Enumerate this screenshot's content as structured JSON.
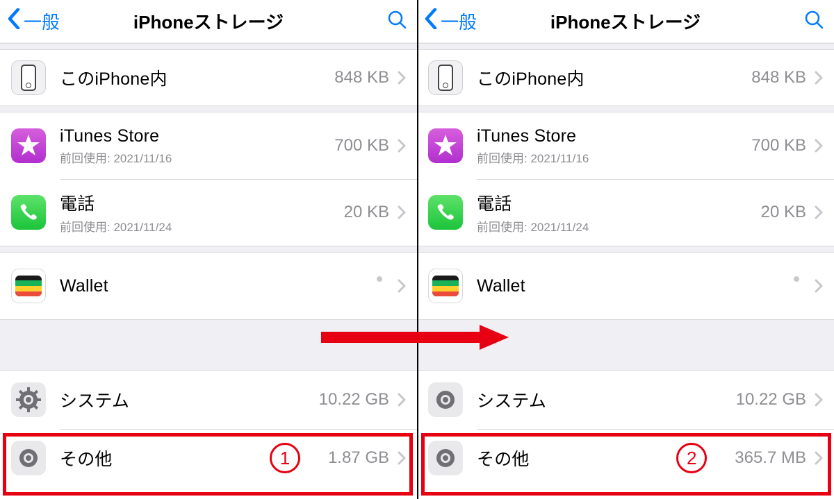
{
  "panes": [
    {
      "nav": {
        "back": "一般",
        "title": "iPhoneストレージ"
      },
      "group1": [
        {
          "icon": "oniphone",
          "title": "このiPhone内",
          "sub": "",
          "size": "848 KB",
          "spinner": false
        },
        {
          "icon": "itunes",
          "title": "iTunes Store",
          "sub": "前回使用: 2021/11/16",
          "size": "700 KB",
          "spinner": false
        },
        {
          "icon": "phone",
          "title": "電話",
          "sub": "前回使用: 2021/11/24",
          "size": "20 KB",
          "spinner": false
        },
        {
          "icon": "wallet",
          "title": "Wallet",
          "sub": "",
          "size": "",
          "spinner": true
        }
      ],
      "group2": [
        {
          "icon": "gear",
          "title": "システム",
          "size": "10.22 GB"
        },
        {
          "icon": "gear",
          "title": "その他",
          "size": "1.87 GB"
        }
      ],
      "callout": "1"
    },
    {
      "nav": {
        "back": "一般",
        "title": "iPhoneストレージ"
      },
      "group1": [
        {
          "icon": "oniphone",
          "title": "このiPhone内",
          "sub": "",
          "size": "848 KB",
          "spinner": false
        },
        {
          "icon": "itunes",
          "title": "iTunes Store",
          "sub": "前回使用: 2021/11/16",
          "size": "700 KB",
          "spinner": false
        },
        {
          "icon": "phone",
          "title": "電話",
          "sub": "前回使用: 2021/11/24",
          "size": "20 KB",
          "spinner": false
        },
        {
          "icon": "wallet",
          "title": "Wallet",
          "sub": "",
          "size": "",
          "spinner": true
        }
      ],
      "group2": [
        {
          "icon": "gear",
          "title": "システム",
          "size": "10.22 GB"
        },
        {
          "icon": "gear",
          "title": "その他",
          "size": "365.7 MB"
        }
      ],
      "callout": "2"
    }
  ],
  "labels": {
    "last_used_prefix": "前回使用: "
  }
}
